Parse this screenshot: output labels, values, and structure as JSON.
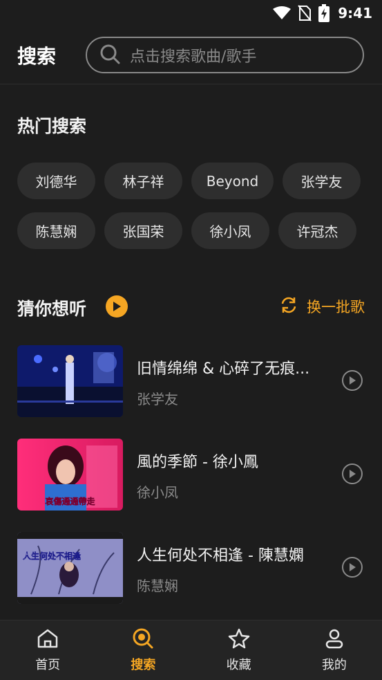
{
  "status_bar": {
    "time": "9:41"
  },
  "header": {
    "title": "搜索",
    "search_placeholder": "点击搜索歌曲/歌手"
  },
  "hot_search": {
    "title": "热门搜索",
    "chips": [
      "刘德华",
      "林子祥",
      "Beyond",
      "张学友",
      "陈慧娴",
      "张国荣",
      "徐小凤",
      "许冠杰"
    ]
  },
  "guess": {
    "title": "猜你想听",
    "refresh_label": "换一批歌",
    "songs": [
      {
        "name": "旧情绵绵 & 心碎了无痕...",
        "artist": "张学友"
      },
      {
        "name": "風的季節 - 徐小鳳",
        "artist": "徐小凤"
      },
      {
        "name": "人生何处不相逢 - 陳慧嫻",
        "artist": "陈慧娴"
      }
    ]
  },
  "thumb_text": {
    "song2": "哀傷通通帶走",
    "song3": "人生何处不相逢"
  },
  "nav": [
    {
      "label": "首页",
      "icon": "home-icon"
    },
    {
      "label": "搜索",
      "icon": "search-icon"
    },
    {
      "label": "收藏",
      "icon": "star-icon"
    },
    {
      "label": "我的",
      "icon": "user-icon"
    }
  ],
  "colors": {
    "accent": "#f5a623",
    "background": "#1d1d1d",
    "chip": "#2e2e2e",
    "muted": "#8a8a8a"
  }
}
